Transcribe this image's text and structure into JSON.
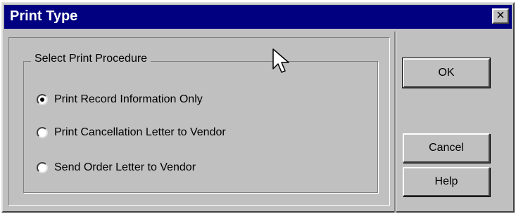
{
  "window": {
    "title": "Print Type",
    "close_symbol": "×"
  },
  "group": {
    "legend": "Select Print Procedure",
    "options": [
      {
        "label": "Print Record Information Only",
        "selected": true
      },
      {
        "label": "Print Cancellation Letter to Vendor",
        "selected": false
      },
      {
        "label": "Send Order Letter to Vendor",
        "selected": false
      }
    ]
  },
  "buttons": {
    "ok": "OK",
    "cancel": "Cancel",
    "help": "Help"
  },
  "icons": {
    "close": "close-icon",
    "cursor": "mouse-pointer-icon"
  }
}
